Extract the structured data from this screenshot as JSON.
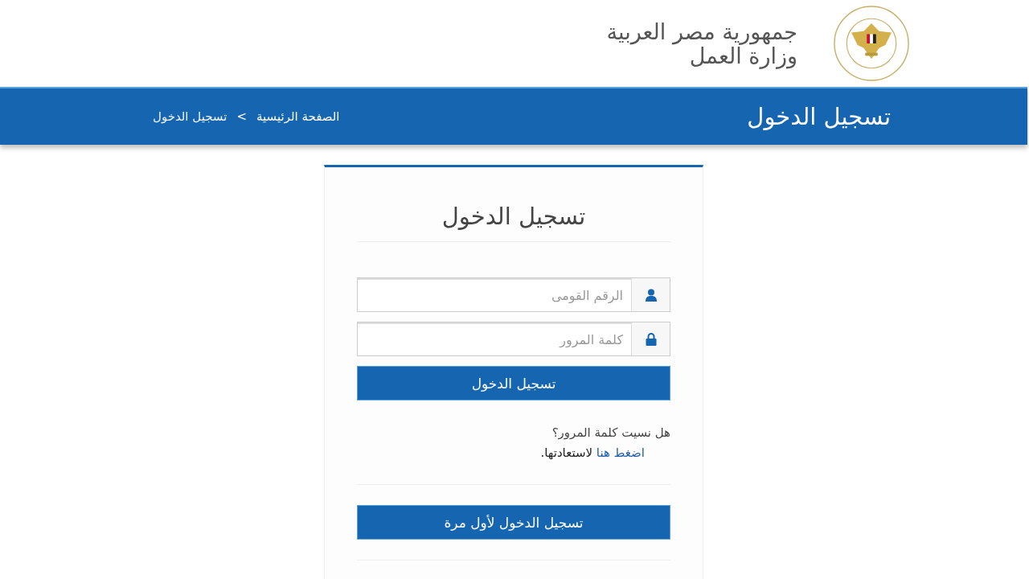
{
  "header": {
    "title_lines": [
      "جمهورية مصر العربية",
      "وزارة العمل"
    ]
  },
  "page_bar": {
    "title": "تسجيل الدخول",
    "breadcrumb": [
      {
        "label": "الصفحة الرئيسية",
        "kind": "link"
      },
      {
        "label": ">",
        "kind": "separator"
      },
      {
        "label": "تسجيل الدخول",
        "kind": "current"
      }
    ]
  },
  "login_card": {
    "title": "تسجيل الدخول",
    "fields": [
      {
        "kind": "user",
        "placeholder": "الرقم القومى"
      },
      {
        "kind": "lock",
        "placeholder": "كلمة المرور"
      }
    ],
    "submit_button": "تسجيل الدخول",
    "forgot": {
      "question": "هل نسيت كلمة المرور؟",
      "link": "اضغط هنا",
      "rest": "لاستعادتها."
    },
    "first_login_button": "تسجيل الدخول لأول مرة"
  }
}
